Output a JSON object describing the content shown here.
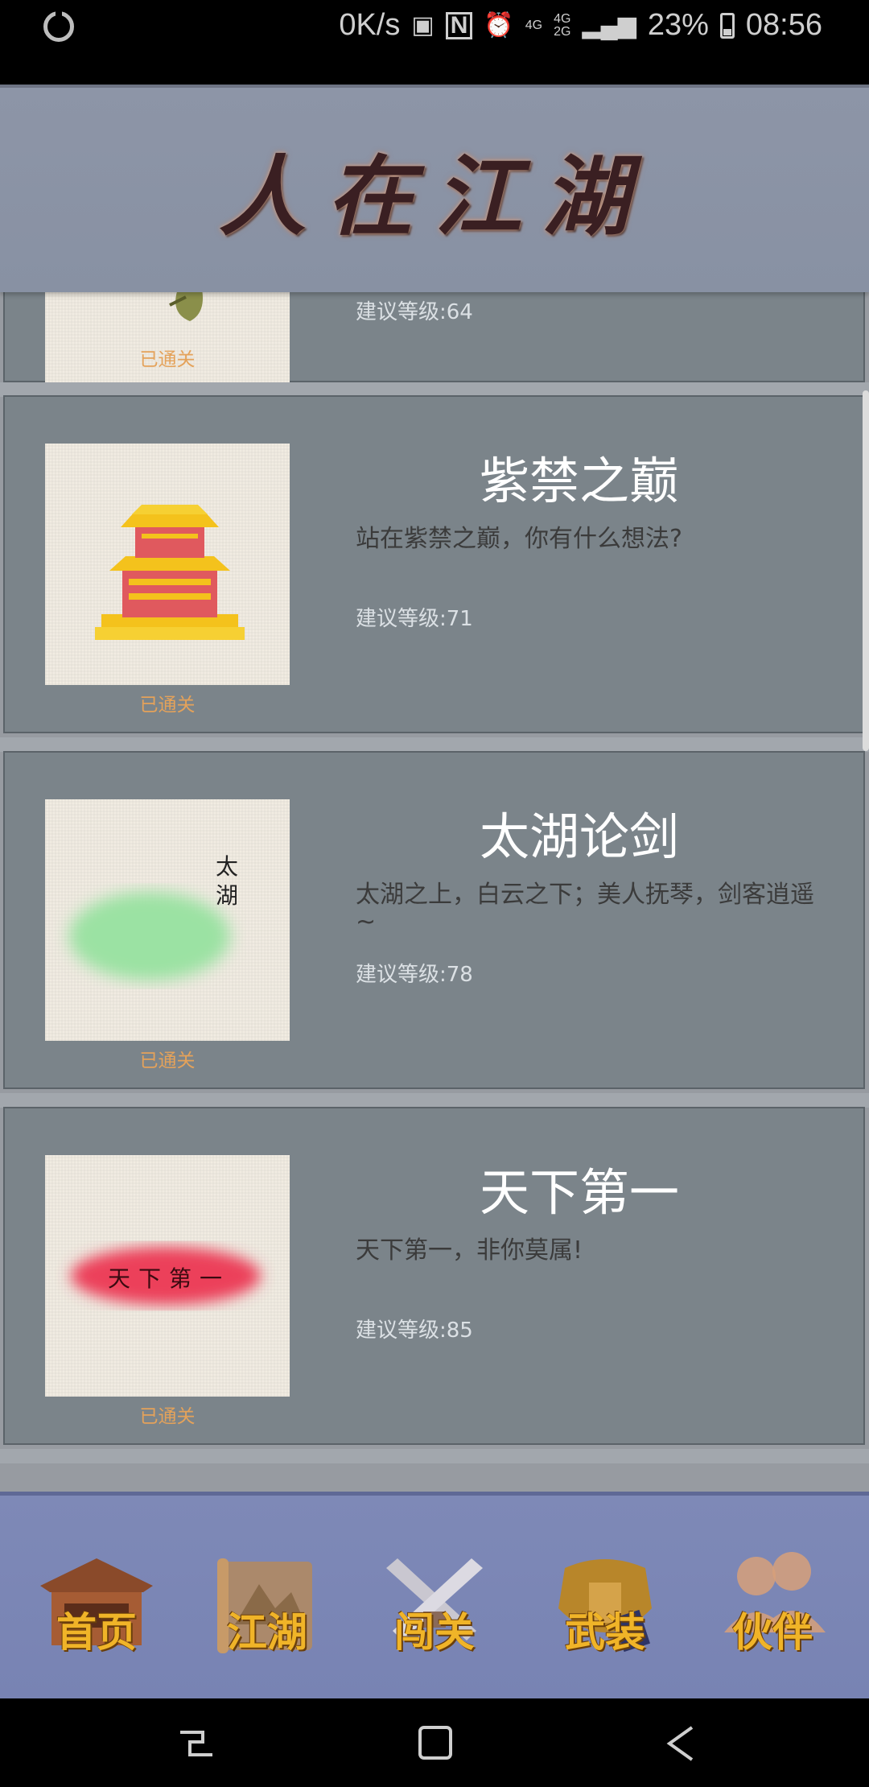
{
  "status_bar": {
    "speed": "0K/s",
    "network_1": "4G",
    "network_2_top": "4G",
    "network_2_bottom": "2G",
    "battery": "23%",
    "time": "08:56"
  },
  "header": {
    "title": "人在江湖"
  },
  "stages": [
    {
      "title": "",
      "desc": "",
      "level": "建议等级:64",
      "status": "已通关"
    },
    {
      "title": "紫禁之巅",
      "desc": "站在紫禁之巅，你有什么想法?",
      "level": "建议等级:71",
      "status": "已通关"
    },
    {
      "title": "太湖论剑",
      "desc": "太湖之上，白云之下；美人抚琴，剑客逍遥~",
      "level": "建议等级:78",
      "status": "已通关",
      "thumb_text": "太湖"
    },
    {
      "title": "天下第一",
      "desc": "天下第一，非你莫属!",
      "level": "建议等级:85",
      "status": "已通关",
      "thumb_text": "天下第一"
    }
  ],
  "tabs": [
    {
      "label": "首页",
      "icon": "house-icon"
    },
    {
      "label": "江湖",
      "icon": "scroll-map-icon"
    },
    {
      "label": "闯关",
      "icon": "crossed-swords-icon"
    },
    {
      "label": "武装",
      "icon": "armor-icon"
    },
    {
      "label": "伙伴",
      "icon": "partners-icon"
    }
  ],
  "colors": {
    "header_bg": "#8d95a7",
    "card_bg": "#7b848a",
    "status_orange": "#e4a25a",
    "tab_bar_bg": "#7e89b7",
    "tab_label": "#f0b428"
  }
}
